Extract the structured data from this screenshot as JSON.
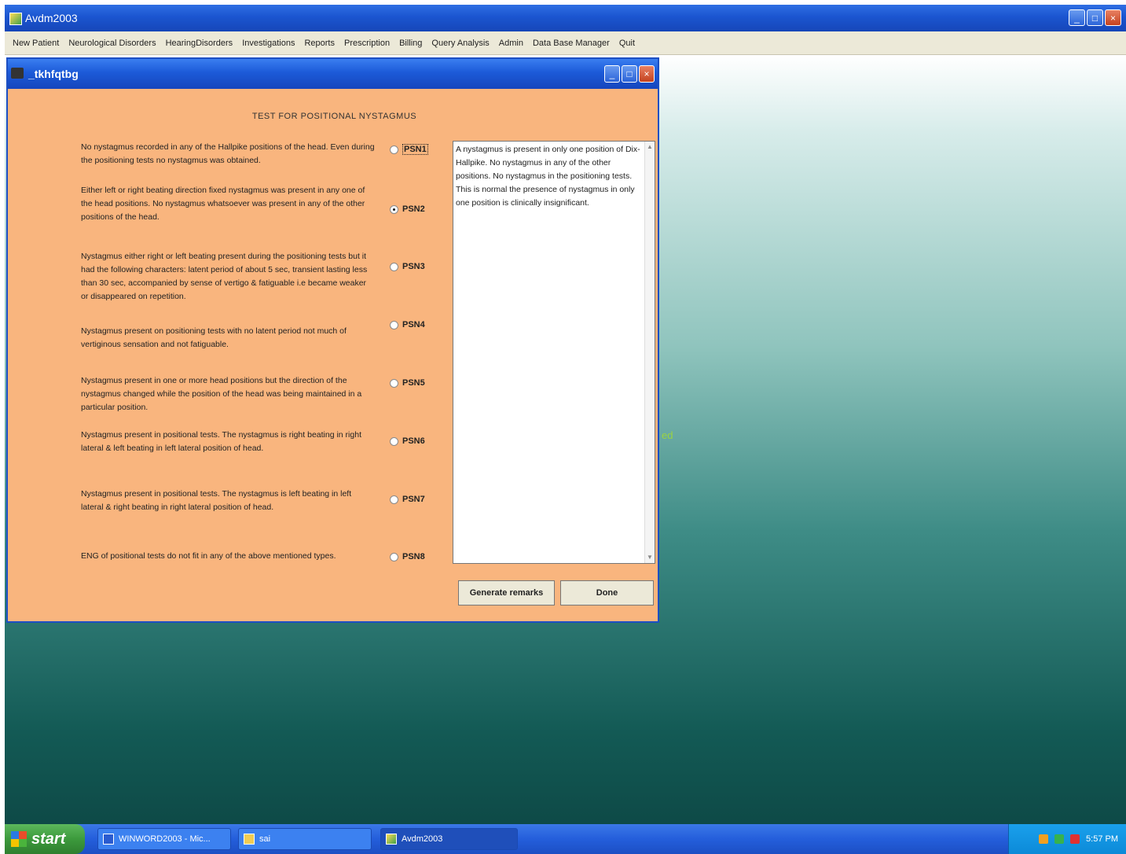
{
  "app": {
    "title": "Avdm2003",
    "window_buttons": [
      "_",
      "□",
      "×"
    ]
  },
  "menu": {
    "items": [
      "New Patient",
      "Neurological Disorders",
      "HearingDisorders",
      "Investigations",
      "Reports",
      "Prescription",
      "Billing",
      "Query Analysis",
      "Admin",
      "Data Base Manager",
      "Quit"
    ]
  },
  "dialog": {
    "title": "_tkhfqtbg",
    "heading": "TEST FOR POSITIONAL NYSTAGMUS",
    "options": [
      {
        "label": "PSN1",
        "checked": false,
        "text": "No nystagmus recorded in any of the Hallpike positions of the head. Even during the positioning tests no nystagmus was obtained."
      },
      {
        "label": "PSN2",
        "checked": true,
        "text": "Either left or right beating direction fixed nystagmus was present in any one of the head positions. No nystagmus whatsoever was present in any of the other positions of the head."
      },
      {
        "label": "PSN3",
        "checked": false,
        "text": "Nystagmus either right or left beating present during the positioning tests but it had the following characters: latent period of about 5 sec, transient lasting less than 30 sec, accompanied by sense of vertigo & fatiguable i.e became weaker or disappeared on repetition."
      },
      {
        "label": "PSN4",
        "checked": false,
        "text": "Nystagmus present on positioning tests with no latent period not much of vertiginous sensation and not fatiguable."
      },
      {
        "label": "PSN5",
        "checked": false,
        "text": "Nystagmus present in one or more head positions but the direction of the nystagmus changed while the position of the head was being maintained in a particular position."
      },
      {
        "label": "PSN6",
        "checked": false,
        "text": "Nystagmus present in positional tests. The nystagmus is right beating in right lateral & left beating in left lateral position of head."
      },
      {
        "label": "PSN7",
        "checked": false,
        "text": "Nystagmus present in positional tests. The nystagmus is left beating in left lateral & right beating in right lateral position of head."
      },
      {
        "label": "PSN8",
        "checked": false,
        "text": "ENG of positional tests do not fit in any of the above mentioned types."
      }
    ],
    "remarks": "A nystagmus is present in only one position of Dix-Hallpike. No nystagmus in any of the other positions. No nystagmus in the positioning tests. This is normal the presence of nystagmus in only one position is clinically insignificant.",
    "buttons": {
      "generate": "Generate remarks",
      "done": "Done"
    }
  },
  "taskbar": {
    "start_label": "start",
    "tasks": [
      "WINWORD2003 - Mic...",
      "sai",
      "Avdm2003"
    ],
    "clock": "5:57 PM"
  }
}
